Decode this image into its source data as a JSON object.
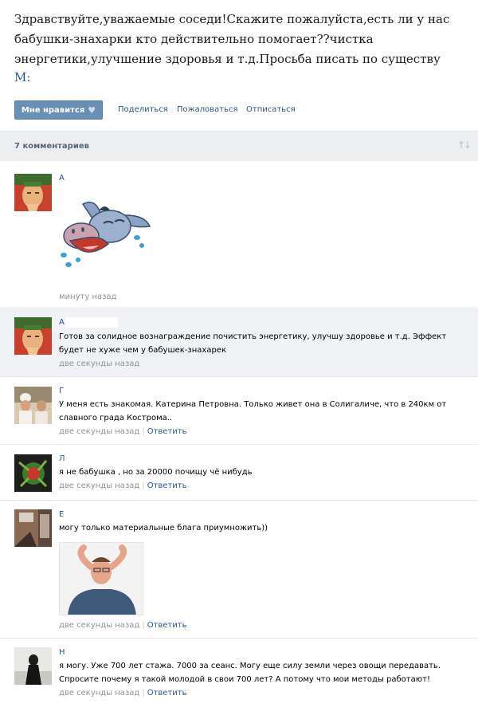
{
  "post": {
    "text": "Здравствуйте,уважаемые соседи!Скажите пожалуйста,есть ли у нас бабушки-знахарки кто действительно помогает??чистка энергетики,улучшение здоровья и т.д.Просьба писать по существу",
    "author_cut": "М:"
  },
  "actions": {
    "like_label": "Мне нравится",
    "share": "Поделиться",
    "report": "Пожаловаться",
    "unsubscribe": "Отписаться"
  },
  "comments_header": {
    "count": "7 комментариев"
  },
  "reply_label": "Ответить",
  "comments": [
    {
      "author": "А",
      "text": "",
      "time": "минуту назад",
      "has_reply": false
    },
    {
      "author": "А",
      "text": "Готов за солидное вознаграждение почистить энергетику, улучшу здоровье и т.д. Эффект будет не хуже чем у бабушек-знахарек",
      "time": "две секунды назад",
      "has_reply": false
    },
    {
      "author": "Г",
      "text": "У меня есть знакомая. Катерина Петровна. Только живет она в Солигаличе, что в 240км от славного града Кострома..",
      "time": "две секунды назад",
      "has_reply": true
    },
    {
      "author": "Л",
      "text": "я не бабушка , но за 20000 почищу чё нибудь",
      "time": "две секунды назад",
      "has_reply": true
    },
    {
      "author": "Е",
      "text": "могу только материальные блага приумножить))",
      "time": "две секунды назад",
      "has_reply": true
    },
    {
      "author": "Н",
      "text": "я могу. Уже 700 лет стажа. 7000 за сеанс. Могу еще силу земли через овощи передавать. Спросите почему я такой молодой в свои 700 лет? А потому что мои методы работают!",
      "time": "две секунды назад",
      "has_reply": true
    }
  ],
  "colors": {
    "link": "#2b5787",
    "button": "#6a8fb5",
    "bar": "#edeef0",
    "highlight": "#f0f2f5",
    "meta": "#939393"
  }
}
